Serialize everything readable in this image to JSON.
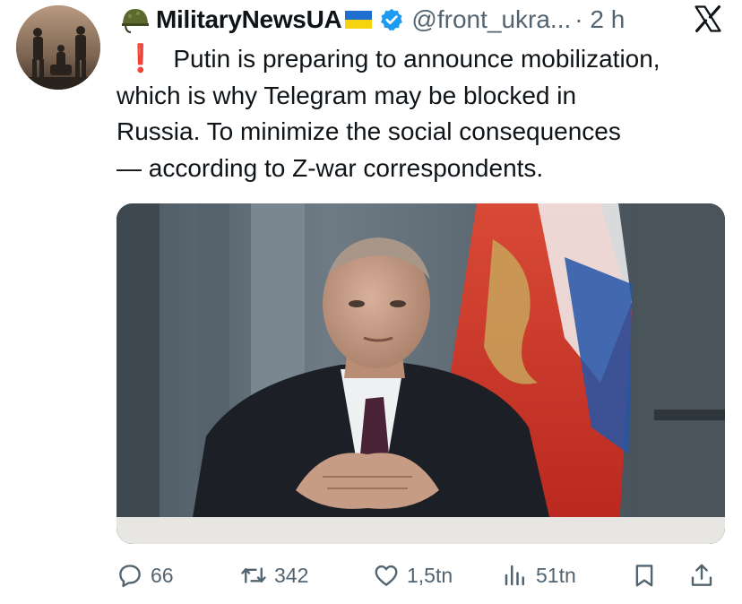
{
  "author": {
    "display_name": "MilitaryNewsUA",
    "handle": "@front_ukra...",
    "time": "· 2 h",
    "helmet_icon": "military-helmet-emoji",
    "flag_icon": "ukraine-flag-emoji",
    "verified_color": "#1d9bf0"
  },
  "tweet": {
    "text": "Putin is preparing to announce mobilization,\nwhich is why Telegram may be blocked in\nRussia. To minimize the social consequences\n— according to Z-war correspondents.",
    "exclaim_glyph": "❗"
  },
  "actions": {
    "replies": "66",
    "retweets": "342",
    "likes": "1,5tn",
    "views": "51tn"
  },
  "colors": {
    "text": "#0f1419",
    "secondary": "#536471",
    "accent_red": "#e0241c"
  }
}
